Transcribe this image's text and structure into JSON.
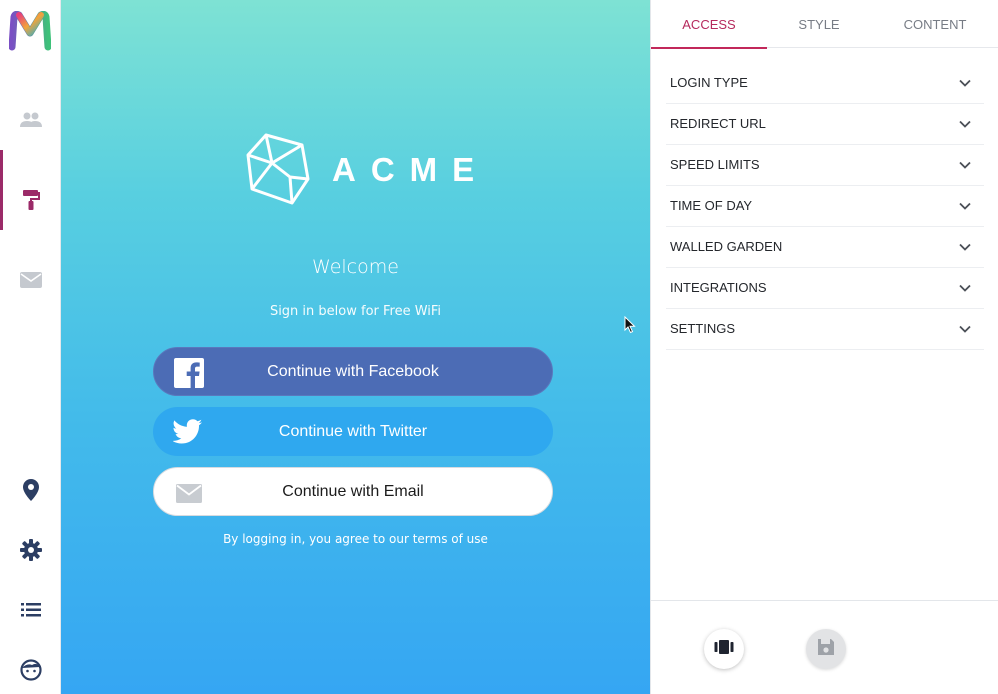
{
  "app": {
    "logo_icon": "m-logo-icon",
    "colors": {
      "accent": "#c2285a",
      "facebook": "#4c6cb5",
      "twitter": "#2fa8ef",
      "gradient_top": "#7ee2d4",
      "gradient_bottom": "#35a6f3"
    }
  },
  "sidebar": {
    "items": [
      {
        "name": "users",
        "icon": "users-icon"
      },
      {
        "name": "design",
        "icon": "paint-roller-icon",
        "active": true
      },
      {
        "name": "messages",
        "icon": "mail-icon"
      },
      {
        "name": "locations",
        "icon": "location-pin-icon"
      },
      {
        "name": "settings",
        "icon": "gear-icon"
      },
      {
        "name": "list",
        "icon": "list-icon"
      },
      {
        "name": "profile",
        "icon": "face-icon"
      }
    ]
  },
  "preview": {
    "brand_name": "ACME",
    "brand_icon": "polyhedron-icon",
    "welcome": "Welcome",
    "subtitle": "Sign in below for Free WiFi",
    "buttons": {
      "facebook": "Continue with Facebook",
      "twitter": "Continue with Twitter",
      "email": "Continue with Email"
    },
    "terms_prefix": "By logging in, you agree to our ",
    "terms_link": "terms of use"
  },
  "panel": {
    "tabs": [
      {
        "label": "ACCESS",
        "active": true
      },
      {
        "label": "STYLE"
      },
      {
        "label": "CONTENT"
      }
    ],
    "sections": [
      {
        "label": "LOGIN TYPE"
      },
      {
        "label": "REDIRECT URL"
      },
      {
        "label": "SPEED LIMITS"
      },
      {
        "label": "TIME OF DAY"
      },
      {
        "label": "WALLED GARDEN"
      },
      {
        "label": "INTEGRATIONS"
      },
      {
        "label": "SETTINGS"
      }
    ],
    "footer": {
      "preview_icon": "device-preview-icon",
      "save_icon": "floppy-disk-icon"
    }
  }
}
